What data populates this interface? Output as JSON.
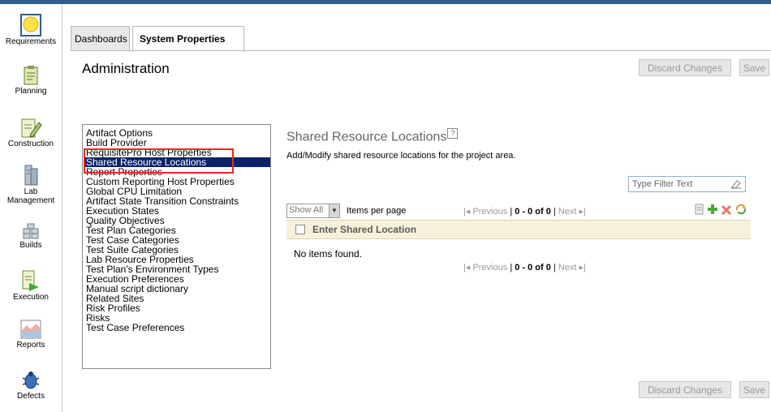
{
  "colors": {
    "accent_bar": "#2f5d8c",
    "selection": "#0a246a",
    "highlight_box": "#e8291e",
    "grid_header": "#f7f1dc"
  },
  "sidebar": {
    "items": [
      {
        "label": "Requirements",
        "icon": "requirements-icon"
      },
      {
        "label": "Planning",
        "icon": "planning-icon"
      },
      {
        "label": "Construction",
        "icon": "construction-icon"
      },
      {
        "label": "Lab\nManagement",
        "icon": "lab-management-icon"
      },
      {
        "label": "Builds",
        "icon": "builds-icon"
      },
      {
        "label": "Execution",
        "icon": "execution-icon"
      },
      {
        "label": "Reports",
        "icon": "reports-icon"
      },
      {
        "label": "Defects",
        "icon": "defects-icon"
      }
    ]
  },
  "tabs": [
    {
      "label": "Dashboards",
      "active": false
    },
    {
      "label": "System Properties",
      "active": true
    }
  ],
  "page_title": "Administration",
  "buttons": {
    "discard": "Discard Changes",
    "save": "Save"
  },
  "settings_list": [
    "Artifact Options",
    "Build Provider",
    "RequisitePro Host Properties",
    "Shared Resource Locations",
    "Report Properties",
    "Custom Reporting Host Properties",
    "Global CPU Limitation",
    "Artifact State Transition Constraints",
    "Execution States",
    "Quality Objectives",
    "Test Plan Categories",
    "Test Case Categories",
    "Test Suite Categories",
    "Lab Resource Properties",
    "Test Plan's Environment Types",
    "Execution Preferences",
    "Manual script dictionary",
    "Related Sites",
    "Risk Profiles",
    "Risks",
    "Test Case Preferences"
  ],
  "selected_item": "Shared Resource Locations",
  "section": {
    "title": "Shared Resource Locations",
    "help": "?",
    "description": "Add/Modify shared resource locations for the project area."
  },
  "filter": {
    "placeholder": "Type Filter Text"
  },
  "table": {
    "show_all": "Show All",
    "items_per_page": "Items per page",
    "pager_prev": "Previous",
    "pager_count": "0 - 0 of 0",
    "pager_next": "Next",
    "column_header": "Enter Shared Location",
    "empty_message": "No items found."
  },
  "toolbar_icons": [
    "edit-icon",
    "add-icon",
    "delete-icon",
    "refresh-icon"
  ]
}
